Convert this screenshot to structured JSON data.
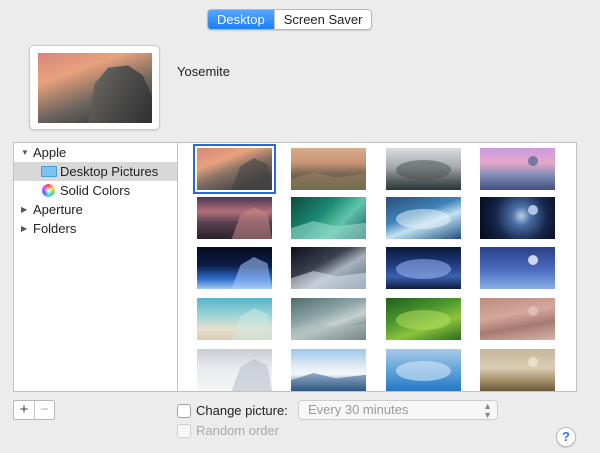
{
  "tabs": [
    {
      "label": "Desktop",
      "active": true
    },
    {
      "label": "Screen Saver",
      "active": false
    }
  ],
  "preview": {
    "name": "Yosemite"
  },
  "sources": [
    {
      "label": "Apple",
      "expanded": true,
      "icon": "disclosure-open-icon"
    },
    {
      "label": "Desktop Pictures",
      "selected": true,
      "icon": "folder-icon"
    },
    {
      "label": "Solid Colors",
      "icon": "color-wheel-icon"
    },
    {
      "label": "Aperture",
      "expanded": false,
      "icon": "disclosure-closed-icon"
    },
    {
      "label": "Folders",
      "expanded": false,
      "icon": "disclosure-closed-icon"
    }
  ],
  "glyphs": {
    "expanded": "▼",
    "collapsed": "▶"
  },
  "controls": {
    "add_label": "+",
    "remove_label": "−",
    "change_picture_label": "Change picture:",
    "change_picture_checked": false,
    "interval_value": "Every 30 minutes",
    "random_order_label": "Random order",
    "random_order_enabled": false,
    "help_label": "?"
  },
  "wallpapers": [
    {
      "name": "yosemite-evening",
      "selected": true,
      "bg": "linear-gradient(160deg,#d7857a 0%,#e8a27e 30%,#8d7466 50%,#4a4847 80%)",
      "accent": "#3e3f40"
    },
    {
      "name": "el-capitan",
      "bg": "linear-gradient(180deg,#d7ab8b 0%,#c89574 35%,#7c6956 60%,#3f5737 100%)",
      "accent": "#9c7f62"
    },
    {
      "name": "mountain-mist",
      "bg": "linear-gradient(180deg,#d9dcdf 0%,#a5aaaf 45%,#5c6467 75%,#2a3430 100%)",
      "accent": "#4d5550"
    },
    {
      "name": "purple-dusk",
      "bg": "linear-gradient(180deg,#c89be0 0%,#e7a6c9 35%,#7f8cb7 65%,#3f4f7c 100%)",
      "accent": "#5a6c98"
    },
    {
      "name": "lake-rocks",
      "bg": "linear-gradient(180deg,#4a3654 0%,#b3707a 35%,#5b4254 60%,#2a2228 100%)",
      "accent": "#c98b8b"
    },
    {
      "name": "green-wave",
      "bg": "linear-gradient(135deg,#0c4a3f 0%,#1b8a73 40%,#5fc4a9 65%,#1a5a63 100%)",
      "accent": "#9fe0cf"
    },
    {
      "name": "blue-wave",
      "bg": "linear-gradient(160deg,#2a4e7a 0%,#3f82b8 40%,#c3e2f0 60%,#1e4e80 100%)",
      "accent": "#e6f3fa"
    },
    {
      "name": "galaxy",
      "bg": "radial-gradient(circle at 55% 45%,#b9cde8 0%,#4a6fa6 20%,#16254a 55%,#05081a 100%)",
      "accent": "#cfdcff"
    },
    {
      "name": "earth-horizon",
      "bg": "linear-gradient(180deg,#060b1f 0%,#0d1d4a 45%,#2c6ac8 75%,#9fcaf2 100%)",
      "accent": "#a6c8ff"
    },
    {
      "name": "earth-clouds",
      "bg": "linear-gradient(150deg,#0e1017 0%,#3a4150 40%,#a9b2bd 60%,#4f6a86 100%)",
      "accent": "#dfe6ec"
    },
    {
      "name": "milky-way",
      "bg": "linear-gradient(180deg,#0a1838 0%,#223f86 45%,#3a61b0 70%,#0e1c40 100%)",
      "accent": "#9eb8f0"
    },
    {
      "name": "moon-sky",
      "bg": "linear-gradient(180deg,#2b3f86 0%,#4c6dc0 55%,#8bb0e8 100%)",
      "accent": "#f3f5ff"
    },
    {
      "name": "beach-shore",
      "bg": "linear-gradient(180deg,#57b5c9 0%,#9ad3d6 40%,#e8e0cd 75%,#d8cbb4 100%)",
      "accent": "#cde9e4"
    },
    {
      "name": "cloud-storm",
      "bg": "linear-gradient(160deg,#4f6a70 0%,#8ea6a8 40%,#c5d2d0 60%,#37474d 100%)",
      "accent": "#aab9b8"
    },
    {
      "name": "rice-terraces",
      "bg": "linear-gradient(160deg,#1f5e1c 0%,#4d9a2f 40%,#8cc43c 65%,#2b6b1f 100%)",
      "accent": "#b5dc63"
    },
    {
      "name": "sand-dunes",
      "bg": "linear-gradient(170deg,#b98d84 0%,#d6a79b 40%,#a77a74 65%,#d7b4a6 100%)",
      "accent": "#e6c3b6"
    },
    {
      "name": "snow-drifts",
      "bg": "linear-gradient(180deg,#c9ccd3 0%,#e8eaee 45%,#f5f6f8 100%)",
      "accent": "#b6bcc7"
    },
    {
      "name": "ice-river",
      "bg": "linear-gradient(180deg,#9dc8e8 0%,#e7eef5 45%,#f4f7fa 60%,#2a4e76 100%)",
      "accent": "#35608f"
    },
    {
      "name": "frozen-forest",
      "bg": "linear-gradient(180deg,#a9c9e8 0%,#5aa0d8 55%,#2377c4 100%)",
      "accent": "#e3eef8"
    },
    {
      "name": "foggy-forest",
      "bg": "linear-gradient(180deg,#c6b79b 0%,#d8cdb5 45%,#a48f68 75%,#6b5a3b 100%)",
      "accent": "#efe5cf"
    }
  ]
}
